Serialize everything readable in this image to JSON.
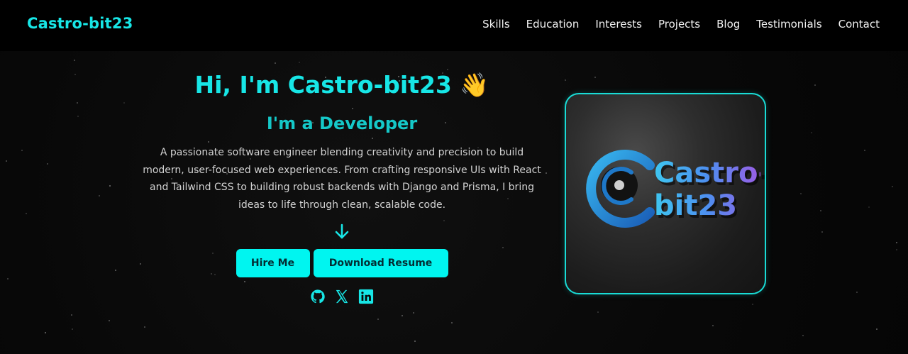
{
  "navbar": {
    "brand": "Castro-bit23",
    "links": [
      "Skills",
      "Education",
      "Interests",
      "Projects",
      "Blog",
      "Testimonials",
      "Contact"
    ]
  },
  "hero": {
    "title": "Hi, I'm Castro-bit23",
    "wave_emoji": "👋",
    "subtitle": "I'm a Developer",
    "description": "A passionate software engineer blending creativity and precision to build modern, user-focused web experiences. From crafting responsive UIs with React and Tailwind CSS to building robust backends with Django and Prisma, I bring ideas to life through clean, scalable code.",
    "scroll_icon": "arrow-down-icon",
    "buttons": {
      "hire": "Hire Me",
      "resume": "Download Resume"
    },
    "socials": [
      "github-icon",
      "x-icon",
      "linkedin-icon"
    ]
  },
  "logo_card": {
    "logo_text_line1": "Castro-",
    "logo_text_line2": "bit23"
  },
  "colors": {
    "accent": "#17e6e6",
    "button_bg": "#00f5f0",
    "background": "#070707",
    "card_border": "#19dcd6"
  }
}
